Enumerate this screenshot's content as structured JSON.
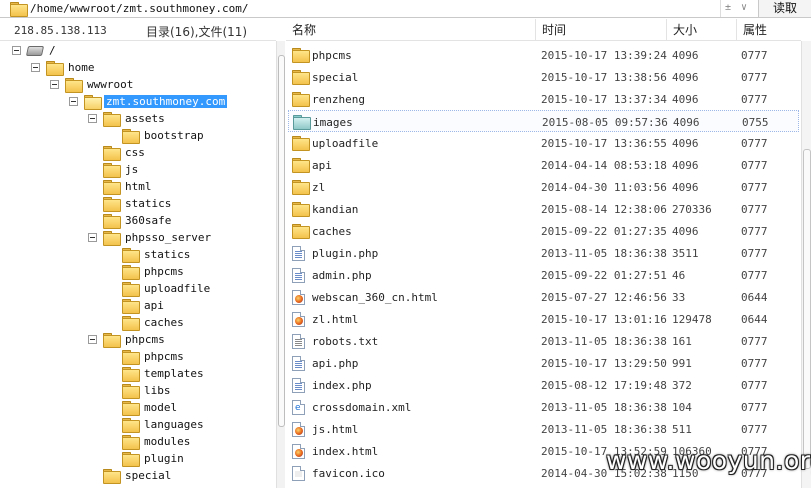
{
  "path_bar": {
    "path": "/home/wwwroot/zmt.southmoney.com/",
    "read_label": "读取",
    "spin_up": "±",
    "dropdown": "∨"
  },
  "left_header": {
    "ip": "218.85.138.113",
    "counts": "目录(16),文件(11)"
  },
  "tree": [
    {
      "label": "/",
      "level": 0,
      "icon": "drive-icon",
      "toggle": true
    },
    {
      "label": "home",
      "level": 1,
      "icon": "folder-icon",
      "toggle": true
    },
    {
      "label": "wwwroot",
      "level": 2,
      "icon": "folder-icon",
      "toggle": true
    },
    {
      "label": "zmt.southmoney.com",
      "level": 3,
      "icon": "folder-open-icon",
      "toggle": true,
      "selected": true
    },
    {
      "label": "assets",
      "level": 4,
      "icon": "folder-icon",
      "toggle": true
    },
    {
      "label": "bootstrap",
      "level": 5,
      "icon": "folder-icon",
      "toggle": false
    },
    {
      "label": "css",
      "level": 4,
      "icon": "folder-icon",
      "toggle": false
    },
    {
      "label": "js",
      "level": 4,
      "icon": "folder-icon",
      "toggle": false
    },
    {
      "label": "html",
      "level": 4,
      "icon": "folder-icon",
      "toggle": false
    },
    {
      "label": "statics",
      "level": 4,
      "icon": "folder-icon",
      "toggle": false
    },
    {
      "label": "360safe",
      "level": 4,
      "icon": "folder-icon",
      "toggle": false
    },
    {
      "label": "phpsso_server",
      "level": 4,
      "icon": "folder-icon",
      "toggle": true
    },
    {
      "label": "statics",
      "level": 5,
      "icon": "folder-icon",
      "toggle": false
    },
    {
      "label": "phpcms",
      "level": 5,
      "icon": "folder-icon",
      "toggle": false
    },
    {
      "label": "uploadfile",
      "level": 5,
      "icon": "folder-icon",
      "toggle": false
    },
    {
      "label": "api",
      "level": 5,
      "icon": "folder-icon",
      "toggle": false
    },
    {
      "label": "caches",
      "level": 5,
      "icon": "folder-icon",
      "toggle": false
    },
    {
      "label": "phpcms",
      "level": 4,
      "icon": "folder-icon",
      "toggle": true
    },
    {
      "label": "phpcms",
      "level": 5,
      "icon": "folder-icon",
      "toggle": false
    },
    {
      "label": "templates",
      "level": 5,
      "icon": "folder-icon",
      "toggle": false
    },
    {
      "label": "libs",
      "level": 5,
      "icon": "folder-icon",
      "toggle": false
    },
    {
      "label": "model",
      "level": 5,
      "icon": "folder-icon",
      "toggle": false
    },
    {
      "label": "languages",
      "level": 5,
      "icon": "folder-icon",
      "toggle": false
    },
    {
      "label": "modules",
      "level": 5,
      "icon": "folder-icon",
      "toggle": false
    },
    {
      "label": "plugin",
      "level": 5,
      "icon": "folder-icon",
      "toggle": false
    },
    {
      "label": "special",
      "level": 4,
      "icon": "folder-icon",
      "toggle": false
    }
  ],
  "columns": {
    "name": "名称",
    "time": "时间",
    "size": "大小",
    "attr": "属性"
  },
  "files": [
    {
      "name": "phpcms",
      "time": "2015-10-17 13:39:24",
      "size": "4096",
      "attr": "0777",
      "icon": "folder-icon"
    },
    {
      "name": "special",
      "time": "2015-10-17 13:38:56",
      "size": "4096",
      "attr": "0777",
      "icon": "folder-icon"
    },
    {
      "name": "renzheng",
      "time": "2015-10-17 13:37:34",
      "size": "4096",
      "attr": "0777",
      "icon": "folder-icon"
    },
    {
      "name": "images",
      "time": "2015-08-05 09:57:36",
      "size": "4096",
      "attr": "0755",
      "icon": "folder-teal-icon",
      "selected": true
    },
    {
      "name": "uploadfile",
      "time": "2015-10-17 13:36:55",
      "size": "4096",
      "attr": "0777",
      "icon": "folder-icon"
    },
    {
      "name": "api",
      "time": "2014-04-14 08:53:18",
      "size": "4096",
      "attr": "0777",
      "icon": "folder-icon"
    },
    {
      "name": "zl",
      "time": "2014-04-30 11:03:56",
      "size": "4096",
      "attr": "0777",
      "icon": "folder-icon"
    },
    {
      "name": "kandian",
      "time": "2015-08-14 12:38:06",
      "size": "270336",
      "attr": "0777",
      "icon": "folder-icon"
    },
    {
      "name": "caches",
      "time": "2015-09-22 01:27:35",
      "size": "4096",
      "attr": "0777",
      "icon": "folder-icon"
    },
    {
      "name": "plugin.php",
      "time": "2013-11-05 18:36:38",
      "size": "3511",
      "attr": "0777",
      "icon": "php-file-icon"
    },
    {
      "name": "admin.php",
      "time": "2015-09-22 01:27:51",
      "size": "46",
      "attr": "0777",
      "icon": "php-file-icon"
    },
    {
      "name": "webscan_360_cn.html",
      "time": "2015-07-27 12:46:56",
      "size": "33",
      "attr": "0644",
      "icon": "html-file-icon"
    },
    {
      "name": "zl.html",
      "time": "2015-10-17 13:01:16",
      "size": "129478",
      "attr": "0644",
      "icon": "html-file-icon"
    },
    {
      "name": "robots.txt",
      "time": "2013-11-05 18:36:38",
      "size": "161",
      "attr": "0777",
      "icon": "txt-file-icon"
    },
    {
      "name": "api.php",
      "time": "2015-10-17 13:29:50",
      "size": "991",
      "attr": "0777",
      "icon": "php-file-icon"
    },
    {
      "name": "index.php",
      "time": "2015-08-12 17:19:48",
      "size": "372",
      "attr": "0777",
      "icon": "php-file-icon"
    },
    {
      "name": "crossdomain.xml",
      "time": "2013-11-05 18:36:38",
      "size": "104",
      "attr": "0777",
      "icon": "xml-file-icon"
    },
    {
      "name": "js.html",
      "time": "2013-11-05 18:36:38",
      "size": "511",
      "attr": "0777",
      "icon": "html-file-icon"
    },
    {
      "name": "index.html",
      "time": "2015-10-17 13:52:59",
      "size": "106360",
      "attr": "0777",
      "icon": "html-file-icon"
    },
    {
      "name": "favicon.ico",
      "time": "2014-04-30 15:02:38",
      "size": "1150",
      "attr": "0777",
      "icon": "ico-file-icon"
    }
  ],
  "watermark": "www.wooyun.org"
}
